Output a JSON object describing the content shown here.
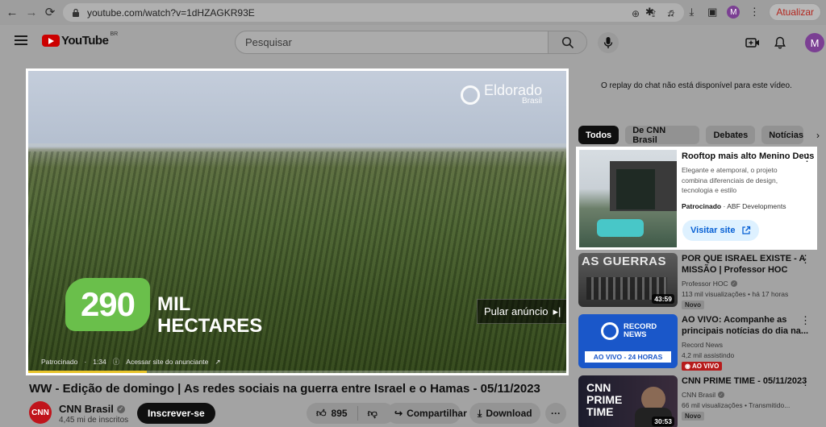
{
  "browser": {
    "url": "youtube.com/watch?v=1dHZAGKR93E",
    "profile_initial": "M",
    "update_label": "Atualizar"
  },
  "header": {
    "logo_text": "YouTube",
    "logo_region": "BR",
    "search_placeholder": "Pesquisar",
    "avatar_initial": "M"
  },
  "player": {
    "watermark_name": "Eldorado",
    "watermark_sub": "Brasil",
    "overlay_number": "290",
    "overlay_unit_line1": "MIL",
    "overlay_unit_line2": "HECTARES",
    "skip_label": "Pular anúncio",
    "ad_label": "Patrocinado",
    "ad_time": "1:34",
    "ad_link": "Acessar site do anunciante",
    "progress_fraction": 0.22
  },
  "video": {
    "title": "WW - Edição de domingo | As redes sociais na guerra entre Israel e o Hamas - 05/11/2023",
    "channel_avatar_text": "CNN",
    "channel": "CNN Brasil",
    "subscribers": "4,45 mi de inscritos",
    "subscribe_label": "Inscrever-se",
    "likes": "895",
    "share_label": "Compartilhar",
    "download_label": "Download"
  },
  "sidebar": {
    "chat_replay": "O replay do chat não está disponível para este vídeo.",
    "chips": [
      "Todos",
      "De CNN Brasil",
      "Debates",
      "Notícias e"
    ],
    "ad": {
      "title": "Rooftop mais alto Menino Deus",
      "description": "Elegante e atemporal, o projeto combina diferenciais de design, tecnologia e estilo",
      "sponsored": "Patrocinado",
      "advertiser": "ABF Developments",
      "button": "Visitar site"
    },
    "recommendations": [
      {
        "title": "POR QUE ISRAEL EXISTE - A MISSÃO | Professor HOC",
        "channel": "Professor HOC",
        "stats": "113 mil visualizações • há 17 horas",
        "badge": "Novo",
        "duration": "43:59",
        "thumb_text": "AS GUERRAS"
      },
      {
        "title": "AO VIVO: Acompanhe as principais notícias do dia na...",
        "channel": "Record News",
        "stats": "4,2 mil assistindo",
        "badge": "AO VIVO",
        "thumb_text": "RECORD NEWS",
        "thumb_sub": "AO VIVO - 24 HORAS"
      },
      {
        "title": "CNN PRIME TIME - 05/11/2023",
        "channel": "CNN Brasil",
        "stats": "66 mil visualizações • Transmitido...",
        "badge": "Novo",
        "duration": "30:53",
        "thumb_text": "CNN PRIME TIME"
      }
    ]
  }
}
